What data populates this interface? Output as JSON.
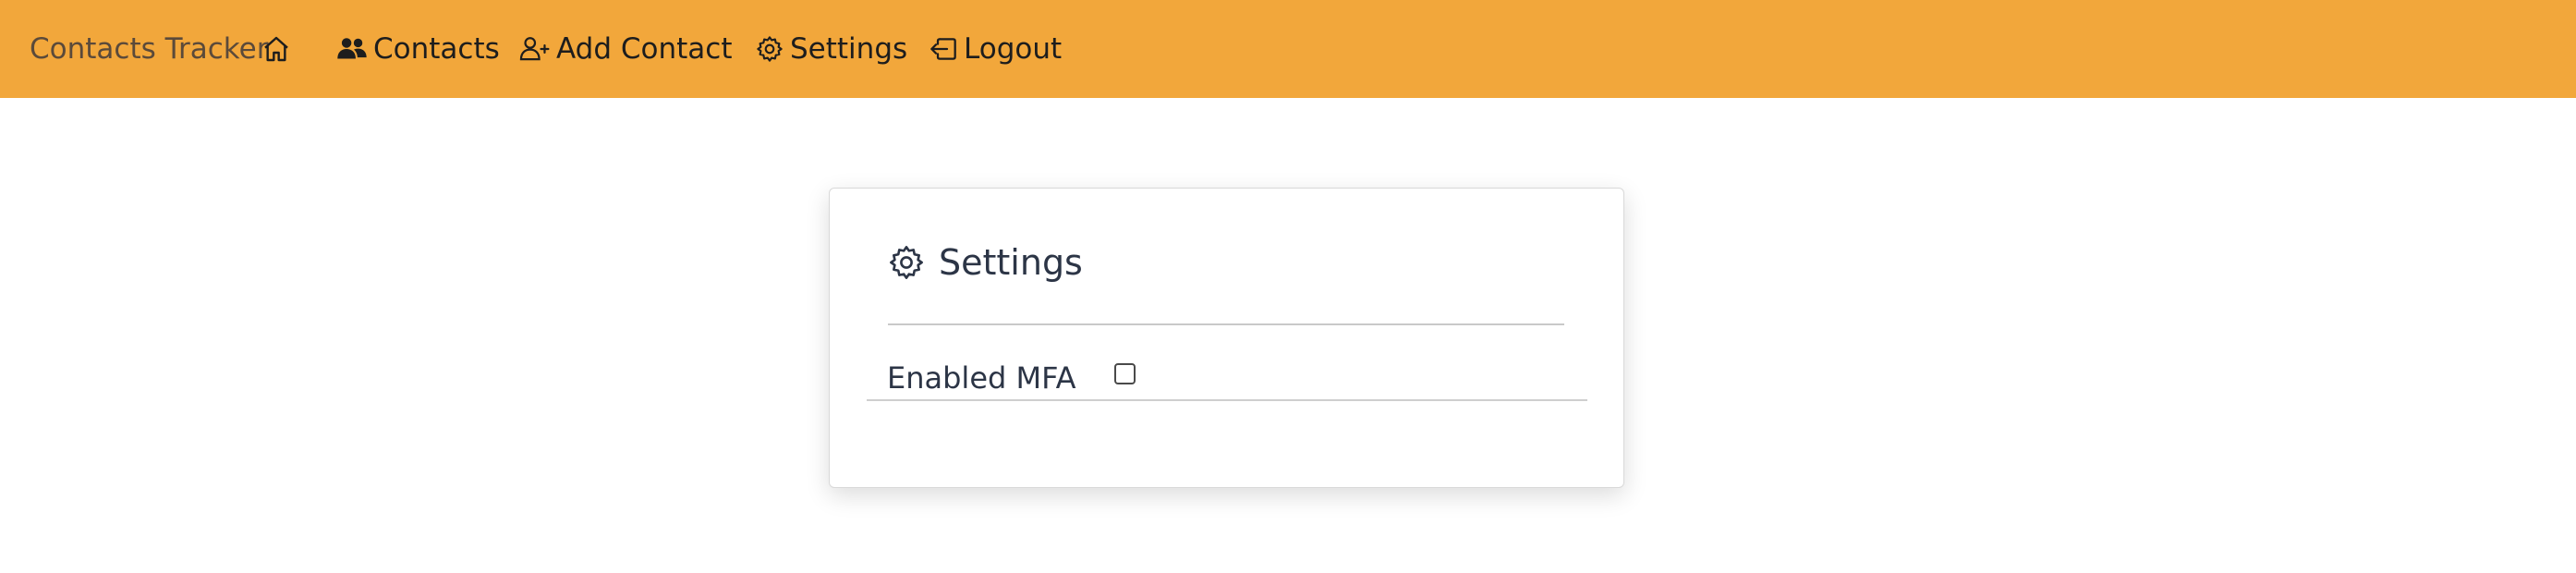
{
  "navbar": {
    "brand": "Contacts Tracker",
    "items": [
      {
        "label": "Contacts",
        "icon": "people-icon"
      },
      {
        "label": "Add Contact",
        "icon": "person-add-icon"
      },
      {
        "label": "Settings",
        "icon": "gear-icon"
      },
      {
        "label": "Logout",
        "icon": "logout-icon"
      }
    ],
    "home_icon": "home-icon",
    "background_color": "#f2a73b"
  },
  "settings_card": {
    "title": "Settings",
    "title_icon": "gear-icon",
    "rows": [
      {
        "label": "Enabled MFA",
        "checked": false
      }
    ]
  }
}
